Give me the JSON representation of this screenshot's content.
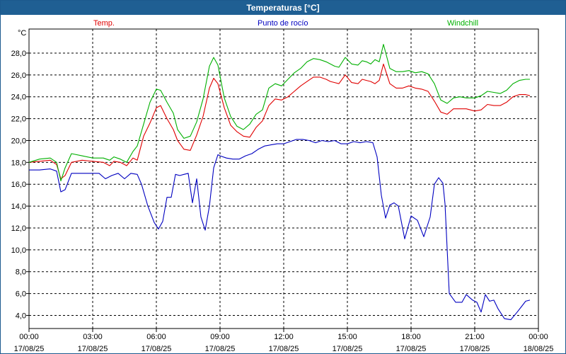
{
  "window": {
    "title": "Temperaturas [°C]"
  },
  "chart_data": {
    "type": "line",
    "title": "Temperaturas [°C]",
    "ylabel": "°C",
    "ylim": [
      2.8,
      30.2
    ],
    "yticks": [
      4,
      6,
      8,
      10,
      12,
      14,
      16,
      18,
      20,
      22,
      24,
      26,
      28
    ],
    "ytick_labels": [
      "4,0",
      "6,0",
      "8,0",
      "10,0",
      "12,0",
      "14,0",
      "16,0",
      "18,0",
      "20,0",
      "22,0",
      "24,0",
      "26,0",
      "28,0"
    ],
    "xlim": [
      0,
      24
    ],
    "xticks": [
      0,
      3,
      6,
      9,
      12,
      15,
      18,
      21,
      24
    ],
    "xtick_labels": [
      {
        "time": "00:00",
        "date": "17/08/25"
      },
      {
        "time": "03:00",
        "date": "17/08/25"
      },
      {
        "time": "06:00",
        "date": "17/08/25"
      },
      {
        "time": "09:00",
        "date": "17/08/25"
      },
      {
        "time": "12:00",
        "date": "17/08/25"
      },
      {
        "time": "15:00",
        "date": "17/08/25"
      },
      {
        "time": "18:00",
        "date": "17/08/25"
      },
      {
        "time": "21:00",
        "date": "17/08/25"
      },
      {
        "time": "00:00",
        "date": "18/08/25"
      }
    ],
    "grid": true,
    "legend_position": "top",
    "series": [
      {
        "name": "Temp.",
        "color": "#e00000",
        "x": [
          0,
          0.5,
          1,
          1.3,
          1.5,
          1.7,
          2,
          2.5,
          3,
          3.5,
          3.8,
          4,
          4.3,
          4.6,
          4.9,
          5.1,
          5.4,
          5.7,
          6,
          6.2,
          6.5,
          6.8,
          7,
          7.3,
          7.6,
          7.9,
          8.2,
          8.5,
          8.7,
          8.9,
          9.2,
          9.5,
          9.8,
          10.1,
          10.4,
          10.7,
          11,
          11.3,
          11.6,
          11.9,
          12.2,
          12.5,
          12.8,
          13.1,
          13.4,
          13.7,
          14,
          14.2,
          14.4,
          14.6,
          14.9,
          15.2,
          15.5,
          15.7,
          15.9,
          16.1,
          16.3,
          16.5,
          16.7,
          17,
          17.3,
          17.6,
          17.9,
          18.2,
          18.5,
          18.8,
          19.1,
          19.4,
          19.7,
          20,
          20.3,
          20.6,
          21,
          21.3,
          21.6,
          21.9,
          22.2,
          22.5,
          22.8,
          23.1,
          23.4,
          23.6
        ],
        "values": [
          18.0,
          18.1,
          18.2,
          17.8,
          16.5,
          16.8,
          18.0,
          18.2,
          18.1,
          18.0,
          17.7,
          18.1,
          18.0,
          17.7,
          18.4,
          18.2,
          20.4,
          21.6,
          23.0,
          23.2,
          22.0,
          21.0,
          20.0,
          19.2,
          19.1,
          20.5,
          22.2,
          24.8,
          25.7,
          25.2,
          23.0,
          21.4,
          20.8,
          20.4,
          20.3,
          21.2,
          21.8,
          23.2,
          23.8,
          23.7,
          24.0,
          24.5,
          25.0,
          25.4,
          25.8,
          25.8,
          25.6,
          25.4,
          25.3,
          25.2,
          26.0,
          25.3,
          25.2,
          25.6,
          25.5,
          25.4,
          25.2,
          25.5,
          27.0,
          25.2,
          24.8,
          24.8,
          25.0,
          24.8,
          24.7,
          24.5,
          23.6,
          22.6,
          22.4,
          22.9,
          22.9,
          22.9,
          22.7,
          22.8,
          23.3,
          23.2,
          23.2,
          23.5,
          24.0,
          24.2,
          24.2,
          24.1
        ]
      },
      {
        "name": "Punto de rocío",
        "color": "#0000c0",
        "x": [
          0,
          0.5,
          1,
          1.3,
          1.5,
          1.7,
          2,
          2.5,
          3,
          3.3,
          3.6,
          3.9,
          4.2,
          4.5,
          4.8,
          5.1,
          5.3,
          5.6,
          5.9,
          6.1,
          6.3,
          6.5,
          6.7,
          6.9,
          7.1,
          7.3,
          7.5,
          7.7,
          7.9,
          8.1,
          8.3,
          8.5,
          8.7,
          8.9,
          9.0,
          9.3,
          9.6,
          9.9,
          10.2,
          10.5,
          10.8,
          11.1,
          11.4,
          11.7,
          12,
          12.3,
          12.6,
          12.9,
          13.2,
          13.5,
          13.8,
          14.1,
          14.4,
          14.7,
          15,
          15.3,
          15.6,
          15.9,
          16.2,
          16.4,
          16.6,
          16.8,
          17,
          17.2,
          17.4,
          17.7,
          18,
          18.3,
          18.6,
          18.9,
          19.1,
          19.3,
          19.5,
          19.6,
          19.8,
          20.1,
          20.4,
          20.6,
          20.9,
          21.1,
          21.3,
          21.5,
          21.7,
          21.9,
          22.1,
          22.4,
          22.7,
          23,
          23.2,
          23.4,
          23.6
        ],
        "values": [
          17.3,
          17.3,
          17.4,
          17.2,
          15.3,
          15.5,
          17.0,
          17.0,
          17.0,
          17.0,
          16.5,
          16.8,
          17.0,
          16.5,
          17.0,
          16.9,
          16.0,
          14.0,
          12.5,
          11.9,
          12.6,
          14.8,
          14.8,
          16.9,
          16.8,
          16.9,
          17.0,
          14.3,
          16.5,
          13.0,
          11.8,
          14.0,
          17.5,
          18.7,
          18.6,
          18.4,
          18.3,
          18.3,
          18.6,
          18.8,
          19.2,
          19.5,
          19.6,
          19.7,
          19.7,
          19.9,
          20.1,
          20.1,
          20.0,
          19.8,
          20.0,
          19.9,
          20.0,
          19.7,
          19.7,
          19.9,
          19.8,
          19.9,
          19.8,
          18.5,
          15.0,
          12.9,
          14.1,
          14.3,
          14.0,
          11.0,
          13.1,
          12.7,
          11.2,
          13.0,
          16.0,
          16.6,
          16.1,
          14.2,
          6.0,
          5.2,
          5.2,
          5.9,
          5.4,
          5.2,
          4.3,
          5.9,
          5.3,
          5.4,
          4.6,
          3.7,
          3.6,
          4.3,
          4.8,
          5.3,
          5.4
        ]
      },
      {
        "name": "Windchill",
        "color": "#00b000",
        "x": [
          0,
          0.5,
          1,
          1.3,
          1.5,
          1.7,
          2,
          2.5,
          3,
          3.5,
          3.8,
          4,
          4.3,
          4.6,
          4.9,
          5.1,
          5.4,
          5.7,
          6,
          6.2,
          6.5,
          6.8,
          7,
          7.3,
          7.6,
          7.9,
          8.2,
          8.5,
          8.7,
          8.9,
          9.2,
          9.5,
          9.8,
          10.1,
          10.4,
          10.7,
          11,
          11.3,
          11.6,
          11.9,
          12.2,
          12.5,
          12.8,
          13.1,
          13.4,
          13.7,
          14,
          14.2,
          14.4,
          14.6,
          14.9,
          15.2,
          15.5,
          15.7,
          15.9,
          16.1,
          16.3,
          16.5,
          16.7,
          17,
          17.3,
          17.6,
          17.9,
          18.2,
          18.5,
          18.8,
          19.1,
          19.4,
          19.7,
          20,
          20.3,
          20.6,
          21,
          21.3,
          21.6,
          21.9,
          22.2,
          22.5,
          22.8,
          23.1,
          23.4,
          23.6
        ],
        "values": [
          18.0,
          18.3,
          18.4,
          18.0,
          16.3,
          17.5,
          18.8,
          18.6,
          18.4,
          18.4,
          18.2,
          18.5,
          18.3,
          18.0,
          19.0,
          19.5,
          21.5,
          23.5,
          24.7,
          24.6,
          23.5,
          22.5,
          21.0,
          20.2,
          20.4,
          21.7,
          23.8,
          26.8,
          27.6,
          26.9,
          23.9,
          22.2,
          21.3,
          21.0,
          21.5,
          22.4,
          22.8,
          24.8,
          25.2,
          25.0,
          25.6,
          26.2,
          26.6,
          27.2,
          27.5,
          27.4,
          27.2,
          27.0,
          26.8,
          26.7,
          27.6,
          27.0,
          26.9,
          27.3,
          27.2,
          27.0,
          27.4,
          27.2,
          28.8,
          26.6,
          26.3,
          26.3,
          26.4,
          26.2,
          26.3,
          26.1,
          25.2,
          23.7,
          23.4,
          23.9,
          24.0,
          23.9,
          23.9,
          24.1,
          24.5,
          24.4,
          24.3,
          24.6,
          25.2,
          25.5,
          25.6,
          25.6
        ]
      }
    ]
  }
}
